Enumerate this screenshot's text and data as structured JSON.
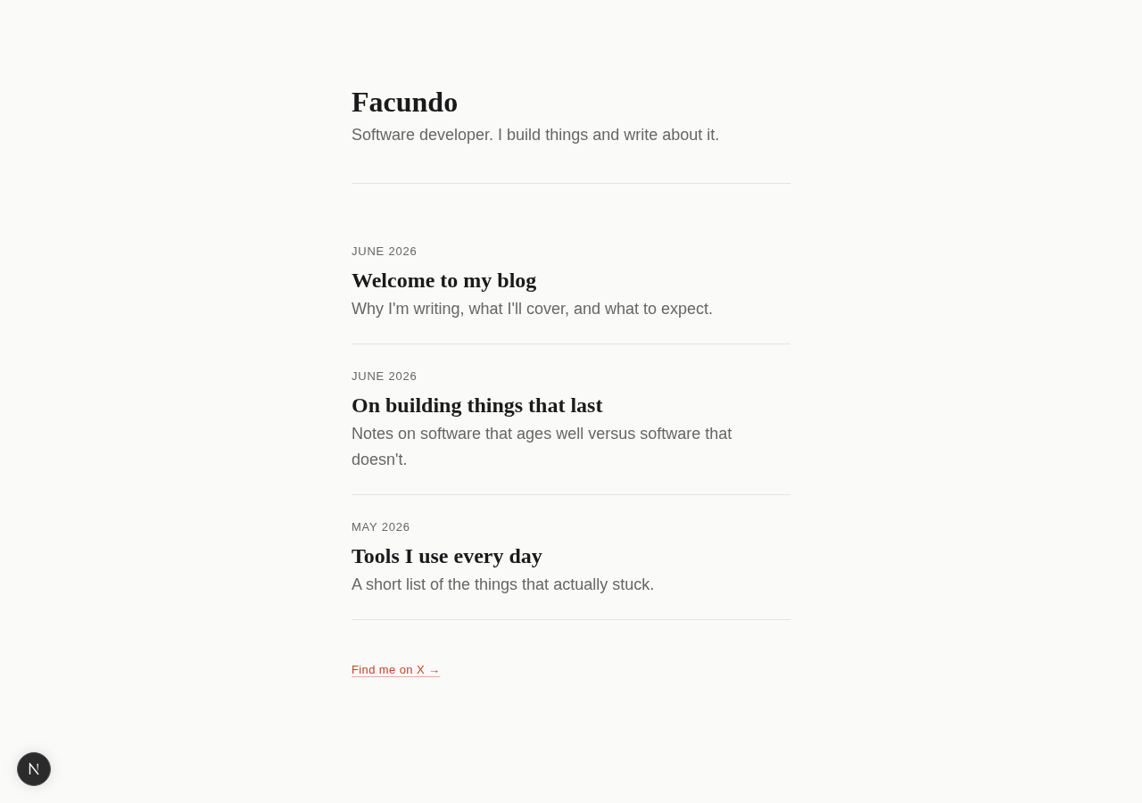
{
  "header": {
    "title": "Facundo",
    "tagline": "Software developer. I build things and write about it."
  },
  "posts": [
    {
      "date": "JUNE 2026",
      "title": "Welcome to my blog",
      "excerpt": "Why I'm writing, what I'll cover, and what to expect."
    },
    {
      "date": "JUNE 2026",
      "title": "On building things that last",
      "excerpt": "Notes on software that ages well versus software that doesn't."
    },
    {
      "date": "MAY 2026",
      "title": "Tools I use every day",
      "excerpt": "A short list of the things that actually stuck."
    }
  ],
  "footer": {
    "link": "Find me on X →"
  }
}
